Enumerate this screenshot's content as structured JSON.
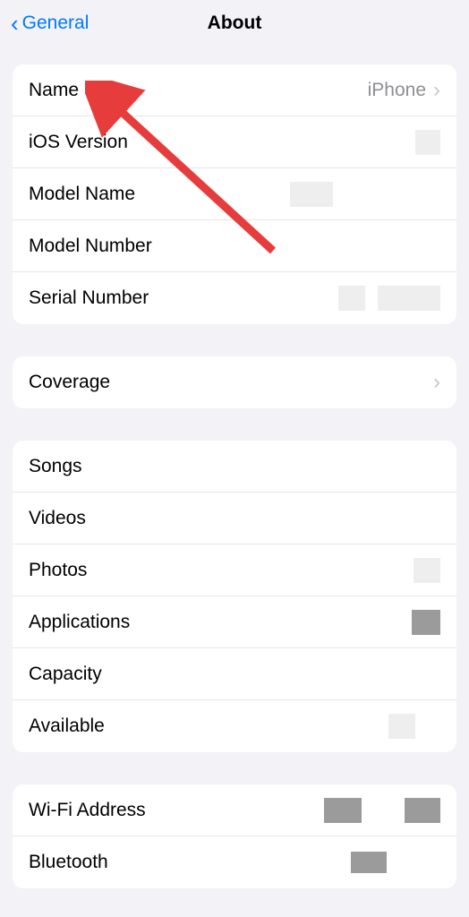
{
  "nav": {
    "back_label": "General",
    "title": "About"
  },
  "sections": {
    "device": {
      "name_label": "Name",
      "name_value": "iPhone",
      "ios_version_label": "iOS Version",
      "model_name_label": "Model Name",
      "model_number_label": "Model Number",
      "serial_number_label": "Serial Number"
    },
    "coverage": {
      "coverage_label": "Coverage"
    },
    "storage": {
      "songs_label": "Songs",
      "videos_label": "Videos",
      "photos_label": "Photos",
      "applications_label": "Applications",
      "capacity_label": "Capacity",
      "available_label": "Available"
    },
    "network": {
      "wifi_label": "Wi-Fi Address",
      "bluetooth_label": "Bluetooth"
    }
  },
  "annotation": {
    "arrow_color": "#e73c3c"
  }
}
